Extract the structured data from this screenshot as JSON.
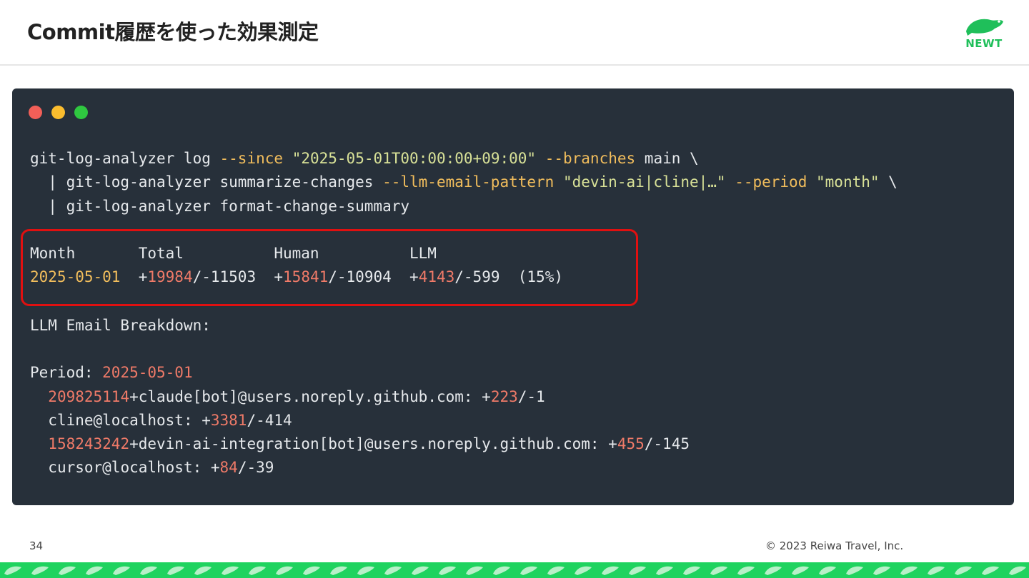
{
  "slide": {
    "title": "Commit履歴を使った効果測定",
    "logo_text": "NEWT",
    "page_number": "34",
    "copyright": "© 2023 Reiwa Travel, Inc."
  },
  "terminal": {
    "command": {
      "l1_a": "git-log-analyzer log ",
      "l1_flag1": "--since",
      "l1_b": " ",
      "l1_str1": "\"2025-05-01T00:00:00+09:00\"",
      "l1_c": " ",
      "l1_flag2": "--branches",
      "l1_d": " main \\",
      "l2_a": "  | git-log-analyzer summarize-changes ",
      "l2_flag1": "--llm-email-pattern",
      "l2_b": " ",
      "l2_str1": "\"devin-ai|cline|…\"",
      "l2_c": " ",
      "l2_flag2": "--period",
      "l2_d": " ",
      "l2_str2": "\"month\"",
      "l2_e": " \\",
      "l3": "  | git-log-analyzer format-change-summary"
    },
    "summary": {
      "header": "Month       Total          Human          LLM",
      "month": "2025-05-01",
      "s1": "  +",
      "total_add": "19984",
      "s2": "/-11503  +",
      "human_add": "15841",
      "s3": "/-10904  +",
      "llm_add": "4143",
      "s4": "/-599  (15%)"
    },
    "breakdown": {
      "heading": "LLM Email Breakdown:",
      "period_label": "Period: ",
      "period_value": "2025-05-01",
      "r1_num": "209825114",
      "r1_mid": "+claude[bot]@users.noreply.github.com: +",
      "r1_add": "223",
      "r1_del": "/-1",
      "r2_mid": "cline@localhost: +",
      "r2_add": "3381",
      "r2_del": "/-414",
      "r3_num": "158243242",
      "r3_mid": "+devin-ai-integration[bot]@users.noreply.github.com: +",
      "r3_add": "455",
      "r3_del": "/-145",
      "r4_mid": "cursor@localhost: +",
      "r4_add": "84",
      "r4_del": "/-39"
    }
  },
  "colors": {
    "terminal_bg": "#27303a",
    "flag": "#f1bd5c",
    "string": "#d8e197",
    "number": "#ef7a68",
    "highlight": "#e01010",
    "brand": "#1fd35f"
  }
}
